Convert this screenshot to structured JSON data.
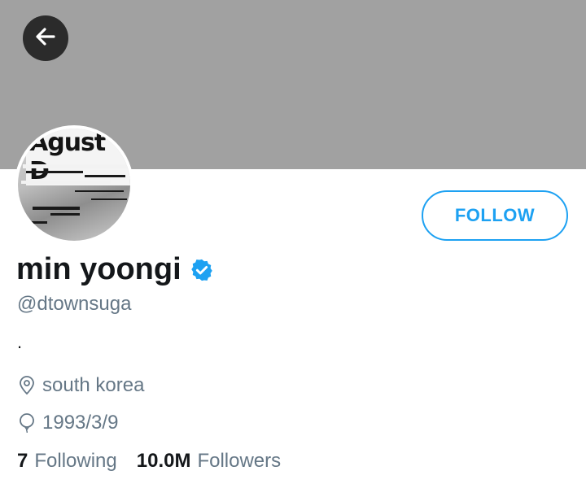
{
  "profile": {
    "name": "min yoongi",
    "handle": "@dtownsuga",
    "bio": ".",
    "location": "south korea",
    "birthday": "1993/3/9",
    "avatar_text": "Agust D",
    "verified": true
  },
  "actions": {
    "follow_label": "FOLLOW"
  },
  "stats": {
    "following_count": "7",
    "following_label": "Following",
    "followers_count": "10.0M",
    "followers_label": "Followers"
  },
  "icons": {
    "back": "arrow-left-icon",
    "verified": "verified-badge-icon",
    "location": "location-pin-icon",
    "birthday": "balloon-icon"
  },
  "colors": {
    "banner": "#a1a1a1",
    "accent": "#1da1f2",
    "text_primary": "#14171a",
    "text_secondary": "#657786"
  }
}
